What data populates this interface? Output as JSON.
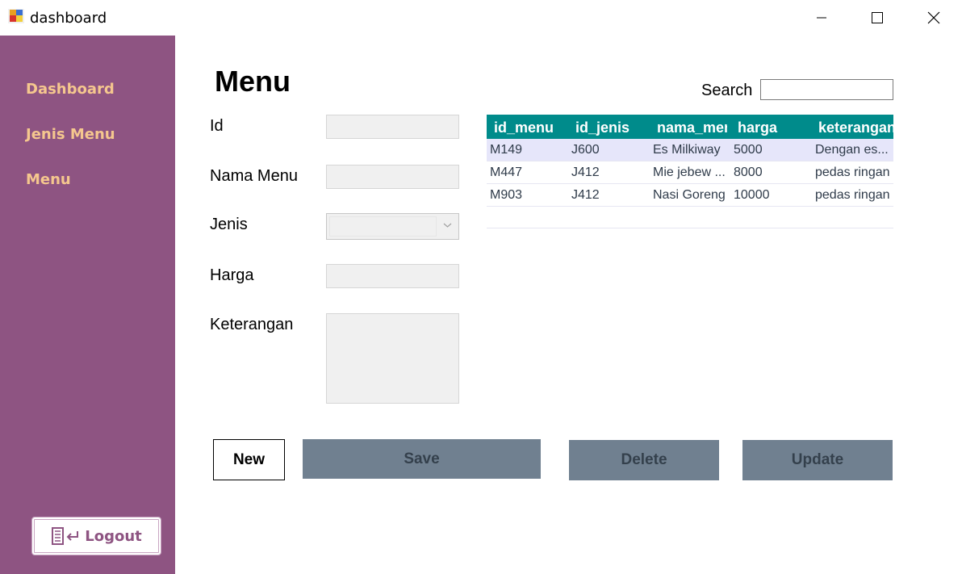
{
  "window": {
    "title": "dashboard",
    "icon": "app-window-icon"
  },
  "sidebar": {
    "items": [
      {
        "label": "Dashboard"
      },
      {
        "label": "Jenis Menu"
      },
      {
        "label": "Menu"
      }
    ],
    "logout_label": "Logout",
    "logout_icon": "door-exit-icon"
  },
  "page": {
    "title": "Menu"
  },
  "form": {
    "id_label": "Id",
    "nama_menu_label": "Nama Menu",
    "jenis_label": "Jenis",
    "harga_label": "Harga",
    "keterangan_label": "Keterangan"
  },
  "search": {
    "label": "Search",
    "value": ""
  },
  "grid": {
    "columns": [
      "id_menu",
      "id_jenis",
      "nama_menu",
      "harga",
      "keterangan"
    ],
    "rows": [
      [
        "M149",
        "J600",
        "Es Milkiway",
        "5000",
        "Dengan es..."
      ],
      [
        "M447",
        "J412",
        "Mie jebew ...",
        "8000",
        "pedas ringan"
      ],
      [
        "M903",
        "J412",
        "Nasi Goreng",
        "10000",
        "pedas ringan"
      ]
    ],
    "selected_row": 0
  },
  "buttons": {
    "new": "New",
    "save": "Save",
    "delete": "Delete",
    "update": "Update"
  },
  "colors": {
    "sidebar_bg": "#8e5482",
    "nav_text": "#f5c78e",
    "grid_header": "#008b8b",
    "button_gray": "#708090",
    "selected_row": "#e6e6fa"
  }
}
